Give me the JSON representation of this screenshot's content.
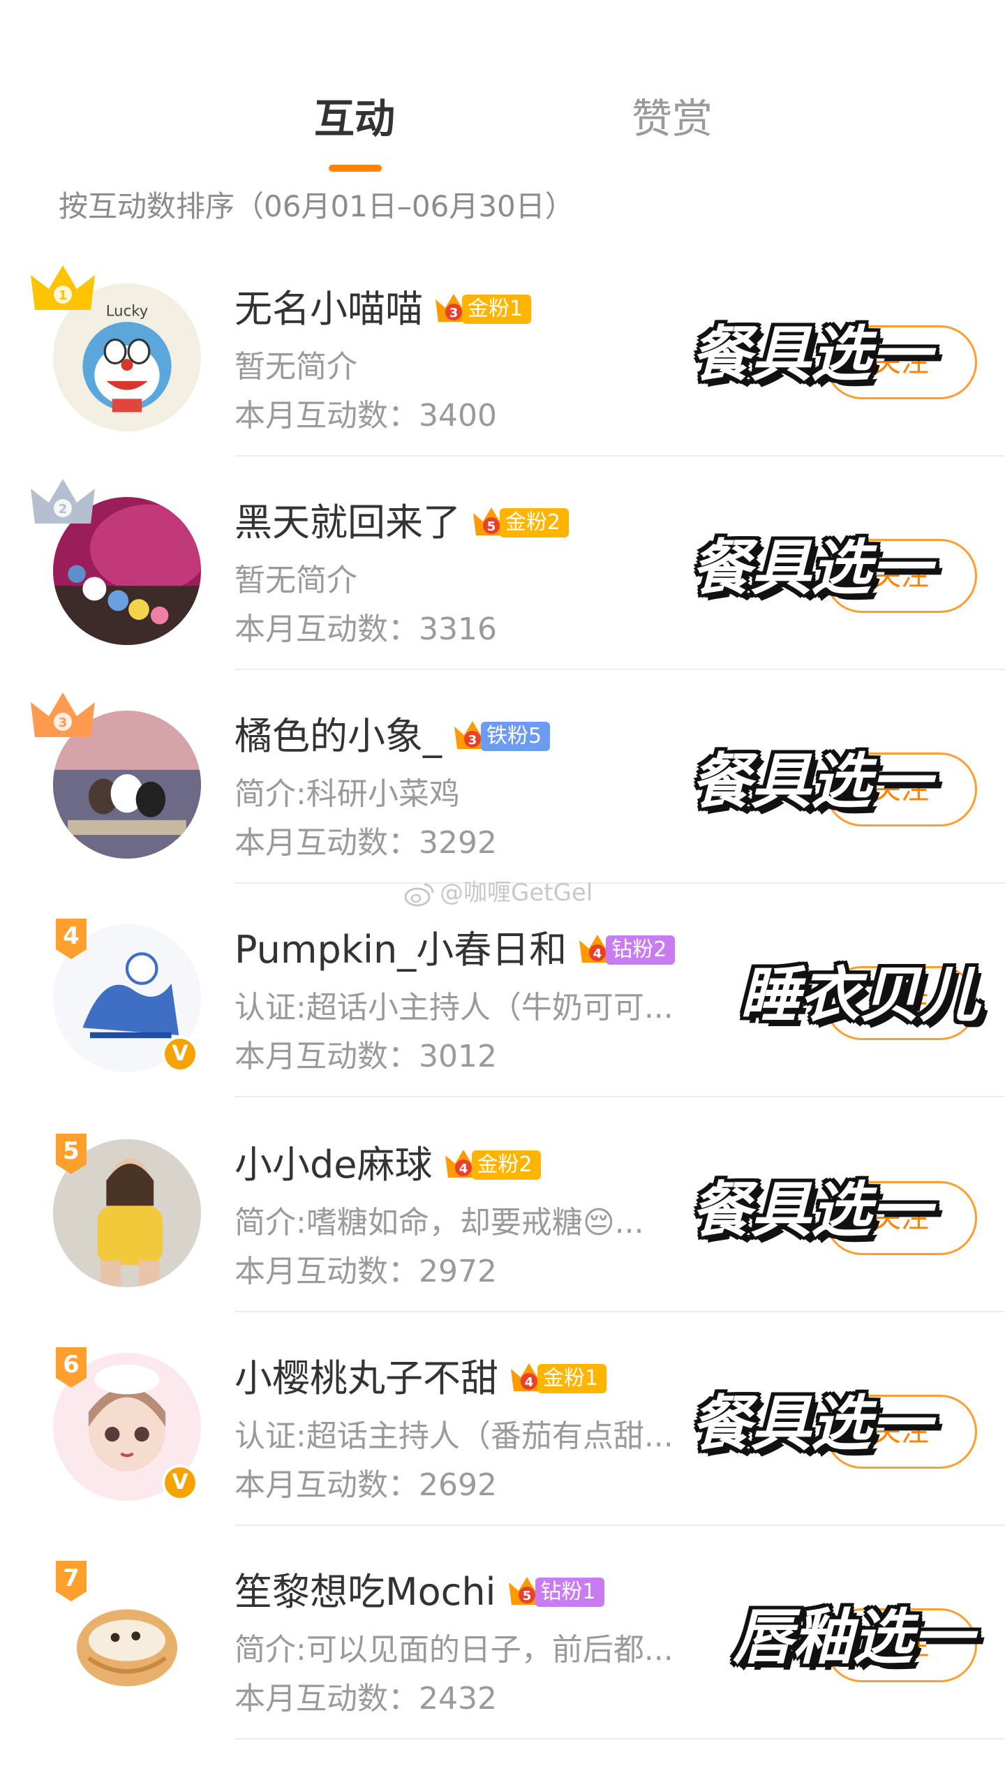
{
  "tabs": [
    {
      "label": "互动",
      "active": true
    },
    {
      "label": "赞赏",
      "active": false
    }
  ],
  "sort_label": "按互动数排序（06月01日–06月30日）",
  "watermark": "@咖喱GetGel",
  "colors": {
    "accent": "#ff8200",
    "gold_badge": "#ffb400",
    "iron_badge": "#6c9bf2",
    "diamond_badge": "#c97bf0",
    "verify": "#f5a300"
  },
  "rows": [
    {
      "rank": "1",
      "rank_style": "gold-crown",
      "name": "无名小喵喵",
      "fan_badge": {
        "level": "3",
        "label": "金粉1",
        "kind": "gold"
      },
      "intro": "暂无简介",
      "count": "本月互动数：3400",
      "follow": "关注",
      "overlay": "餐具选一",
      "avatar_icon": "doraemon-avatar",
      "verified": false
    },
    {
      "rank": "2",
      "rank_style": "silver-crown",
      "name": "黑天就回来了",
      "fan_badge": {
        "level": "5",
        "label": "金粉2",
        "kind": "gold"
      },
      "intro": "暂无简介",
      "count": "本月互动数：3316",
      "follow": "关注",
      "overlay": "餐具选一",
      "avatar_icon": "knit-avatar",
      "verified": false
    },
    {
      "rank": "3",
      "rank_style": "bronze-crown",
      "name": "橘色的小象_",
      "fan_badge": {
        "level": "3",
        "label": "铁粉5",
        "kind": "iron"
      },
      "intro": "简介:科研小菜鸡",
      "count": "本月互动数：3292",
      "follow": "关注",
      "overlay": "餐具选一",
      "avatar_icon": "bears-avatar",
      "verified": false
    },
    {
      "rank": "4",
      "rank_style": "number",
      "name": "Pumpkin_小春日和",
      "fan_badge": {
        "level": "4",
        "label": "钻粉2",
        "kind": "diamond"
      },
      "intro": "认证:超话小主持人（牛奶可可...",
      "count": "本月互动数：3012",
      "follow": "关注",
      "overlay": "睡衣贝儿",
      "avatar_icon": "sketch-avatar",
      "verified": true
    },
    {
      "rank": "5",
      "rank_style": "number",
      "name": "小小de麻球",
      "fan_badge": {
        "level": "4",
        "label": "金粉2",
        "kind": "gold"
      },
      "intro": "简介:嗜糖如命，却要戒糖😔...",
      "count": "本月互动数：2972",
      "follow": "关注",
      "overlay": "餐具选一",
      "avatar_icon": "girl-avatar",
      "verified": false
    },
    {
      "rank": "6",
      "rank_style": "number",
      "name": "小樱桃丸子不甜",
      "fan_badge": {
        "level": "4",
        "label": "金粉1",
        "kind": "gold"
      },
      "intro": "认证:超话主持人（番茄有点甜...",
      "count": "本月互动数：2692",
      "follow": "关注",
      "overlay": "餐具选一",
      "avatar_icon": "anime-avatar",
      "verified": true
    },
    {
      "rank": "7",
      "rank_style": "number",
      "name": "笙黎想吃Mochi",
      "fan_badge": {
        "level": "5",
        "label": "钻粉1",
        "kind": "diamond"
      },
      "intro": "简介:可以见面的日子，前后都...",
      "count": "本月互动数：2432",
      "follow": "关注",
      "overlay": "唇釉选一",
      "avatar_icon": "puff-avatar",
      "verified": false
    }
  ]
}
